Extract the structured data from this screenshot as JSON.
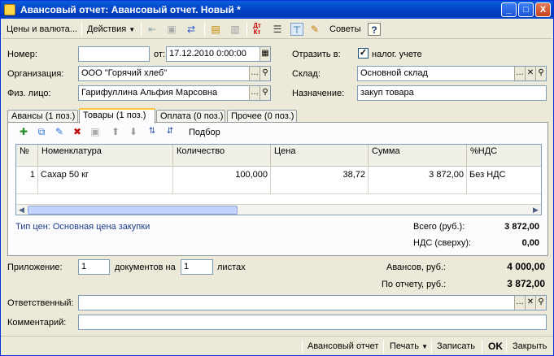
{
  "window": {
    "title": "Авансовый отчет: Авансовый отчет. Новый *",
    "minimize": "_",
    "maximize": "□",
    "close": "X"
  },
  "toolbar": {
    "prices_currency": "Цены и валюта...",
    "actions": "Действия",
    "advice": "Советы",
    "help": "?"
  },
  "header": {
    "number_label": "Номер:",
    "number_value": "",
    "date_label": "от:",
    "date_value": "17.12.2010  0:00:00",
    "reflect_label": "Отразить в:",
    "tax_label": "налог. учете",
    "org_label": "Организация:",
    "org_value": "ООО \"Горячий хлеб\"",
    "warehouse_label": "Склад:",
    "warehouse_value": "Основной склад",
    "person_label": "Физ. лицо:",
    "person_value": "Гарифуллина Альфия Марсовна",
    "purpose_label": "Назначение:",
    "purpose_value": "закуп товара"
  },
  "tabs": [
    {
      "label": "Авансы (1 поз.)"
    },
    {
      "label": "Товары (1 поз.)"
    },
    {
      "label": "Оплата (0 поз.)"
    },
    {
      "label": "Прочее (0 поз.)"
    }
  ],
  "table_toolbar": {
    "selection": "Подбор"
  },
  "table": {
    "columns": [
      "№",
      "Номенклатура",
      "Количество",
      "Цена",
      "Сумма",
      "%НДС"
    ],
    "rows": [
      {
        "n": "1",
        "item": "Сахар  50 кг",
        "qty": "100,000",
        "price": "38,72",
        "sum": "3 872,00",
        "vat": "Без НДС"
      }
    ]
  },
  "summary": {
    "price_type": "Тип цен: Основная цена закупки",
    "total_label": "Всего (руб.):",
    "total_value": "3 872,00",
    "vat_label": "НДС (сверху):",
    "vat_value": "0,00"
  },
  "footer": {
    "attachment_label": "Приложение:",
    "attachment_docs": "1",
    "docs_on_label": "документов на",
    "sheets_value": "1",
    "sheets_label": "листах",
    "advances_label": "Авансов, руб.:",
    "advances_value": "4 000,00",
    "report_label": "По отчету, руб.:",
    "report_value": "3 872,00",
    "responsible_label": "Ответственный:",
    "responsible_value": "",
    "comment_label": "Комментарий:",
    "comment_value": ""
  },
  "bottom": {
    "advance_report": "Авансовый отчет",
    "print": "Печать",
    "save": "Записать",
    "ok": "OK",
    "close": "Закрыть"
  },
  "colors": {
    "titlebar": "#0348c8",
    "window_bg": "#ece9d8",
    "active_tab_accent": "#ffc83c"
  }
}
